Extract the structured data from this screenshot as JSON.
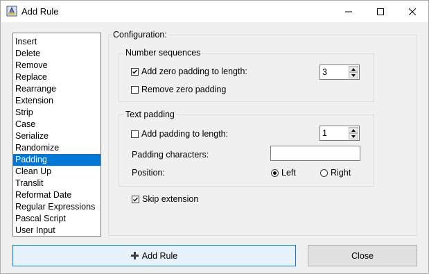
{
  "window": {
    "title": "Add Rule",
    "icon": "app-icon"
  },
  "rules_list": {
    "items": [
      "Insert",
      "Delete",
      "Remove",
      "Replace",
      "Rearrange",
      "Extension",
      "Strip",
      "Case",
      "Serialize",
      "Randomize",
      "Padding",
      "Clean Up",
      "Translit",
      "Reformat Date",
      "Regular Expressions",
      "Pascal Script",
      "User Input"
    ],
    "selected": "Padding"
  },
  "configuration": {
    "title": "Configuration:",
    "number_sequences": {
      "title": "Number sequences",
      "add_zero_padding_label": "Add zero padding to length:",
      "add_zero_padding_checked": true,
      "zero_padding_length": "3",
      "remove_zero_padding_label": "Remove zero padding",
      "remove_zero_padding_checked": false
    },
    "text_padding": {
      "title": "Text padding",
      "add_padding_label": "Add padding to length:",
      "add_padding_checked": false,
      "padding_length": "1",
      "padding_characters_label": "Padding characters:",
      "padding_characters_value": "",
      "position_label": "Position:",
      "position_left": "Left",
      "position_right": "Right",
      "position_selected": "Left"
    },
    "skip_extension_label": "Skip extension",
    "skip_extension_checked": true
  },
  "buttons": {
    "add_rule": "Add Rule",
    "close": "Close"
  }
}
